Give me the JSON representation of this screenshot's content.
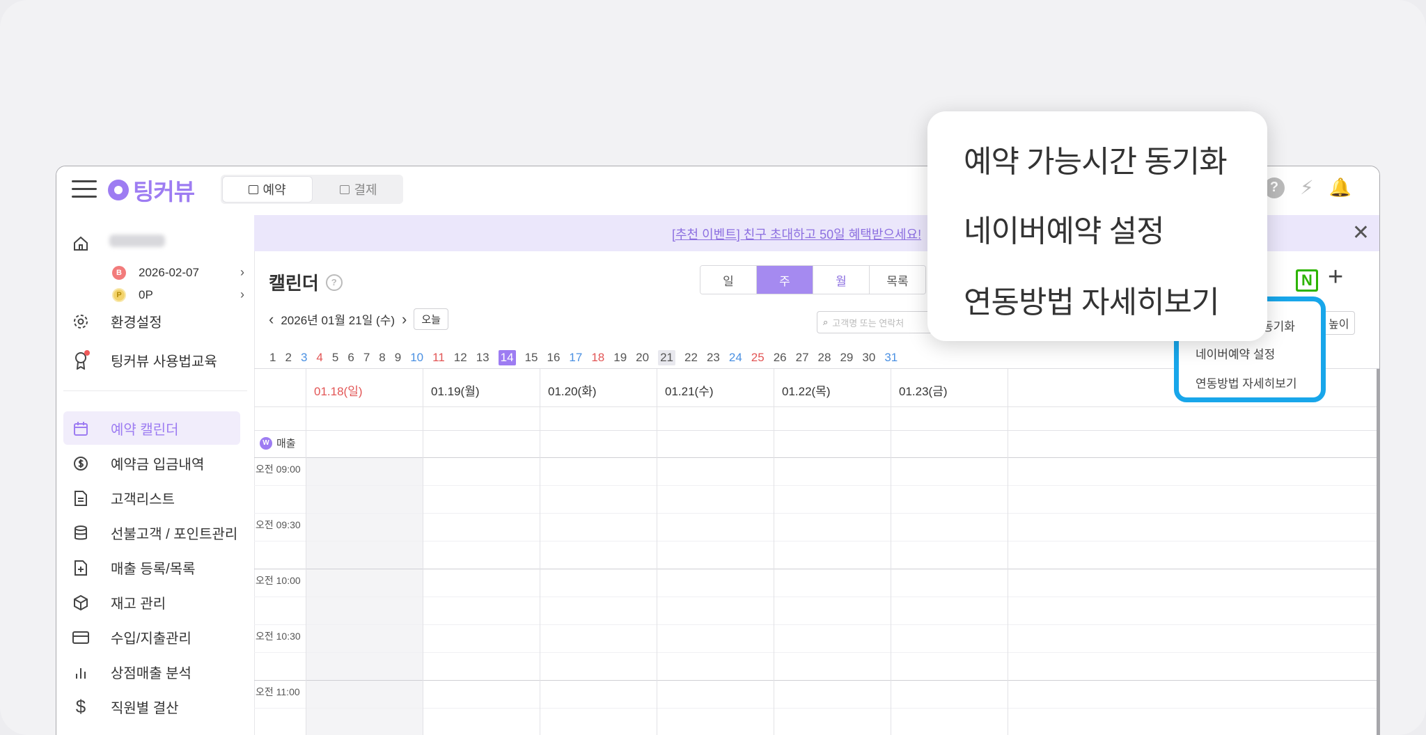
{
  "header": {
    "logo_text": "팅커뷰",
    "mode_tabs": [
      {
        "label": "예약",
        "icon": "calendar-icon",
        "active": true
      },
      {
        "label": "결제",
        "icon": "monitor-icon",
        "active": false
      }
    ],
    "icons": [
      "help-icon",
      "bolt-icon",
      "bell-icon"
    ]
  },
  "sidebar": {
    "expiry_date": "2026-02-07",
    "points": "0P",
    "items_top": [
      {
        "label": "환경설정",
        "icon": "gear-icon"
      },
      {
        "label": "팅커뷰 사용법교육",
        "icon": "award-icon"
      }
    ],
    "items": [
      {
        "label": "예약 캘린더",
        "icon": "calendar-icon",
        "active": true
      },
      {
        "label": "예약금 입금내역",
        "icon": "dollar-circle-icon"
      },
      {
        "label": "고객리스트",
        "icon": "document-icon"
      },
      {
        "label": "선불고객 / 포인트관리",
        "icon": "database-icon"
      },
      {
        "label": "매출 등록/목록",
        "icon": "file-plus-icon"
      },
      {
        "label": "재고 관리",
        "icon": "box-icon"
      },
      {
        "label": "수입/지출관리",
        "icon": "card-icon"
      },
      {
        "label": "상점매출 분석",
        "icon": "bar-chart-icon"
      },
      {
        "label": "직원별 결산",
        "icon": "dollar-icon"
      }
    ]
  },
  "banner": {
    "text": "[추천 이벤트] 친구 초대하고 50일 혜택받으세요!"
  },
  "calendar": {
    "title": "캘린더",
    "view_tabs": [
      "일",
      "주",
      "월",
      "목록"
    ],
    "active_view": "주",
    "current_date": "2026년 01월 21일 (수)",
    "today_label": "오늘",
    "search_placeholder": "고객명 또는 연락처",
    "height_label": "높이",
    "month_days": [
      "1",
      "2",
      "3",
      "4",
      "5",
      "6",
      "7",
      "8",
      "9",
      "10",
      "11",
      "12",
      "13",
      "14",
      "15",
      "16",
      "17",
      "18",
      "19",
      "20",
      "21",
      "22",
      "23",
      "24",
      "25",
      "26",
      "27",
      "28",
      "29",
      "30",
      "31"
    ],
    "selected_day": "14",
    "today_day": "21",
    "day_headers": [
      "01.18(일)",
      "01.19(월)",
      "01.20(화)",
      "01.21(수)",
      "01.22(목)",
      "01.23(금)"
    ],
    "sales_label": "매출",
    "time_slots": [
      "오전 09:00",
      "오전 09:30",
      "오전 10:00",
      "오전 10:30",
      "오전 11:00"
    ]
  },
  "dropdown": {
    "items": [
      "예약 가능시간 동기화",
      "네이버예약 설정",
      "연동방법 자세히보기"
    ]
  },
  "colors": {
    "accent": "#9d7cf2",
    "highlight": "#18a6ea",
    "naver": "#2db400"
  }
}
